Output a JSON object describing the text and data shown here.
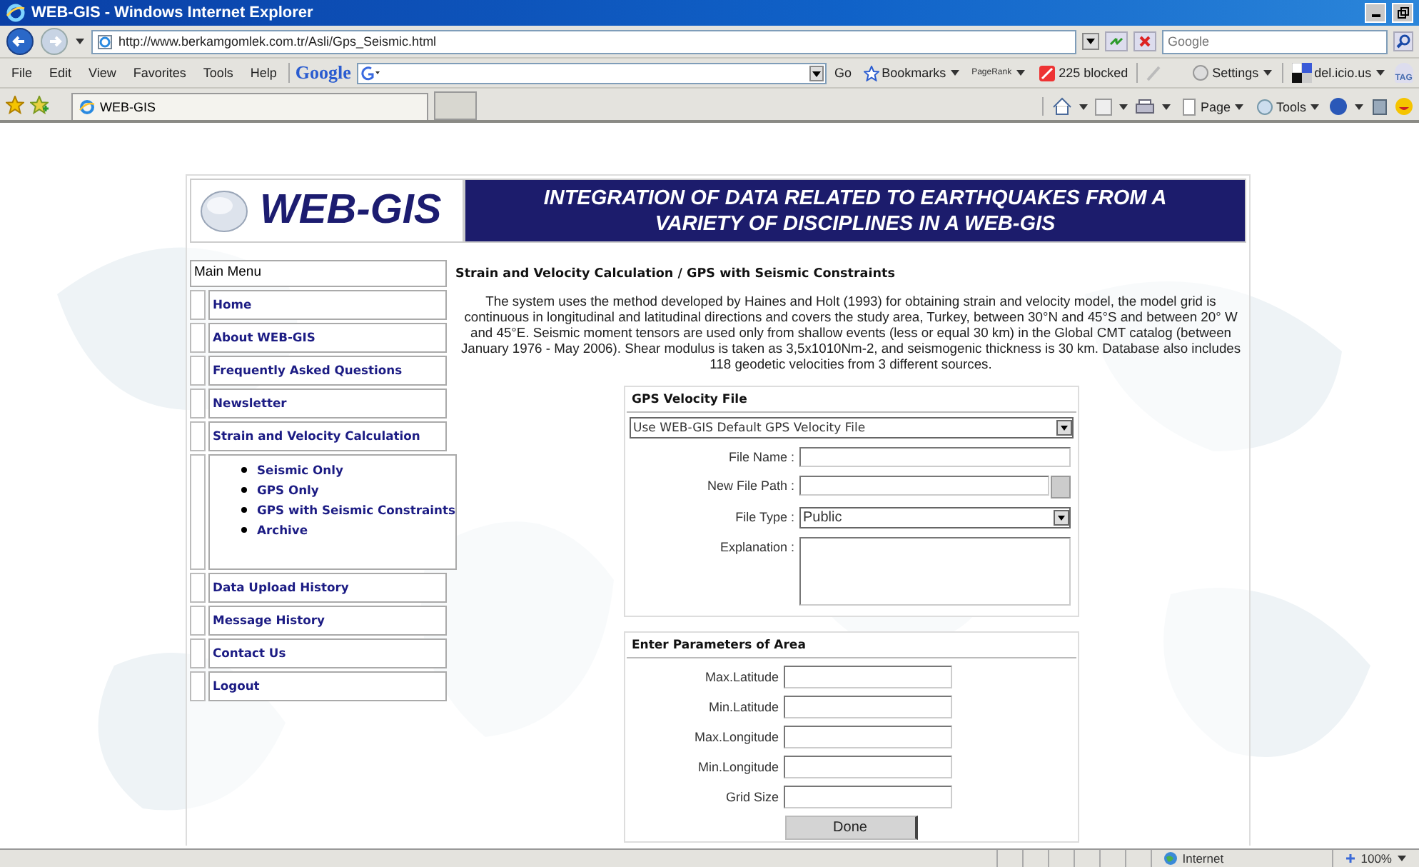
{
  "window": {
    "title": "WEB-GIS - Windows Internet Explorer"
  },
  "address_bar": {
    "url": "http://www.berkamgomlek.com.tr/Asli/Gps_Seismic.html"
  },
  "search": {
    "placeholder": "Google"
  },
  "menu": [
    "File",
    "Edit",
    "View",
    "Favorites",
    "Tools",
    "Help"
  ],
  "google_toolbar": {
    "logo": "Google",
    "go": "Go",
    "bookmarks": "Bookmarks",
    "pagerank": "PageRank",
    "blocked": "225 blocked",
    "settings": "Settings",
    "delicious": "del.icio.us",
    "tag": "TAG"
  },
  "tabs": [
    {
      "label": "WEB-GIS",
      "selected": true
    }
  ],
  "command_bar": [
    "Page",
    "Tools"
  ],
  "page": {
    "logo": "WEB-GIS",
    "banner": "INTEGRATION OF DATA RELATED TO EARTHQUAKES FROM A VARIETY OF DISCIPLINES IN A WEB-GIS",
    "main_menu": {
      "title": "Main Menu",
      "items": [
        {
          "label": "Home"
        },
        {
          "label": "About WEB-GIS"
        },
        {
          "label": "Frequently Asked Questions"
        },
        {
          "label": "Newsletter"
        },
        {
          "label": "Strain and Velocity Calculation",
          "children": [
            {
              "label": "Seismic Only"
            },
            {
              "label": "GPS Only"
            },
            {
              "label": "GPS with Seismic Constraints"
            },
            {
              "label": "Archive"
            }
          ]
        },
        {
          "label": "Data Upload History"
        },
        {
          "label": "Message History"
        },
        {
          "label": "Contact Us"
        },
        {
          "label": "Logout"
        }
      ]
    },
    "heading": "Strain and Velocity Calculation / GPS with Seismic Constraints",
    "description": "The system uses the method developed by Haines and Holt (1993) for obtaining strain and velocity model, the model grid is continuous in longitudinal and latitudinal directions and covers the study area, Turkey, between 30°N and 45°S and between 20° W and 45°E. Seismic moment tensors are used only from shallow events (less or equal 30 km) in the Global CMT catalog (between January 1976 - May 2006). Shear modulus is taken as 3,5x1010Nm-2, and seismogenic thickness is 30 km. Database also includes 118 geodetic velocities from 3 different sources.",
    "gps_panel": {
      "title": "GPS Velocity File",
      "source": "Use WEB-GIS Default GPS Velocity File",
      "fields": [
        {
          "label": "File Name :",
          "kind": "text"
        },
        {
          "label": "New File Path :",
          "kind": "file"
        },
        {
          "label": "File Type :",
          "kind": "select",
          "value": "Public"
        },
        {
          "label": "Explanation :",
          "kind": "textarea"
        }
      ]
    },
    "area_panel": {
      "title": "Enter Parameters of Area",
      "fields": [
        "Max.Latitude",
        "Min.Latitude",
        "Max.Longitude",
        "Min.Longitude",
        "Grid Size"
      ],
      "button": "Done"
    }
  },
  "status_bar": {
    "zone": "Internet",
    "zoom": "100%"
  }
}
